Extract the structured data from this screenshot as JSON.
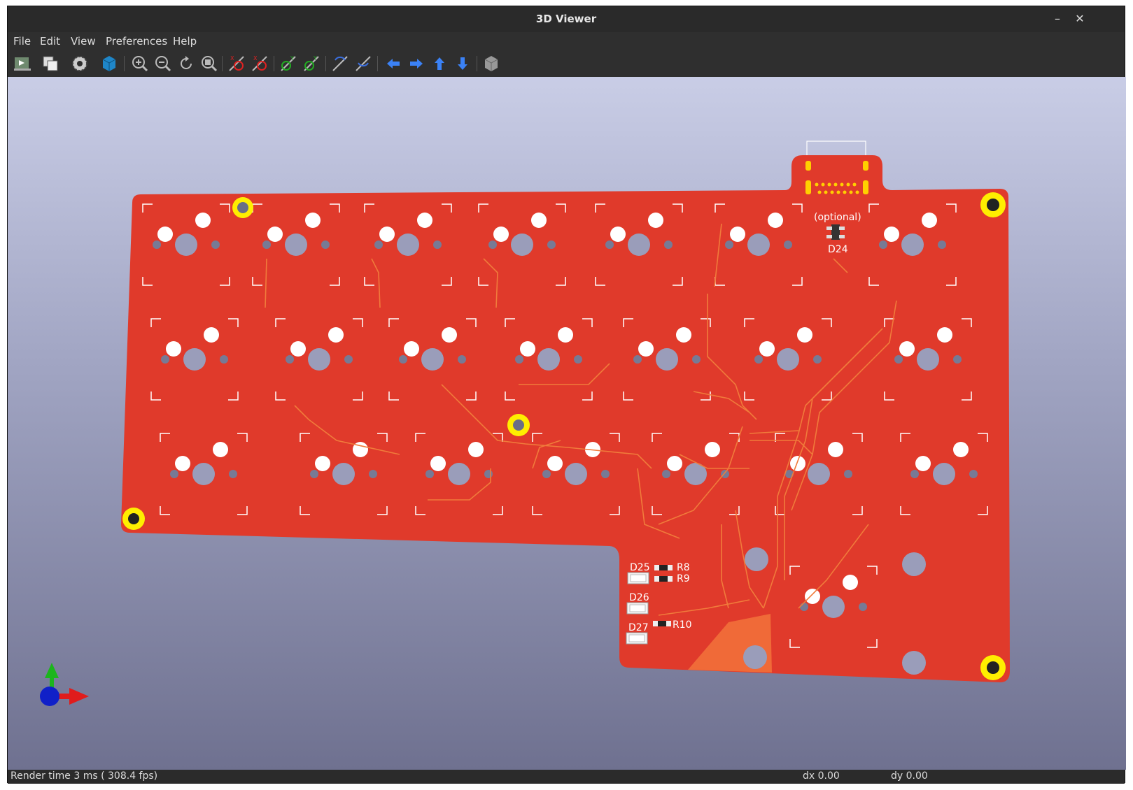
{
  "window": {
    "title": "3D Viewer",
    "minimize": "–",
    "close": "✕"
  },
  "menu": {
    "file": "File",
    "edit": "Edit",
    "view": "View",
    "preferences": "Preferences",
    "help": "Help"
  },
  "toolbar": [
    "render-export-icon",
    "copy-image-icon",
    "settings-gear-icon",
    "raytrace-cube-icon",
    "zoom-in-icon",
    "zoom-out-icon",
    "redraw-icon",
    "zoom-fit-icon",
    "rotate-x-cw-icon",
    "rotate-x-ccw-icon",
    "rotate-y-cw-icon",
    "rotate-y-ccw-icon",
    "rotate-z-cw-icon",
    "rotate-z-ccw-icon",
    "pan-left-icon",
    "pan-right-icon",
    "pan-up-icon",
    "pan-down-icon",
    "view-3d-box-icon"
  ],
  "board": {
    "color": "#e03a2b",
    "labels": {
      "optional": "(optional)",
      "d24": "D24",
      "d25": "D25",
      "d26": "D26",
      "d27": "D27",
      "r8": "R8",
      "r9": "R9",
      "r10": "R10"
    }
  },
  "status": {
    "render_time": "Render time 3 ms ( 308.4 fps)",
    "dx": "dx 0.00",
    "dy": "dy 0.00"
  }
}
